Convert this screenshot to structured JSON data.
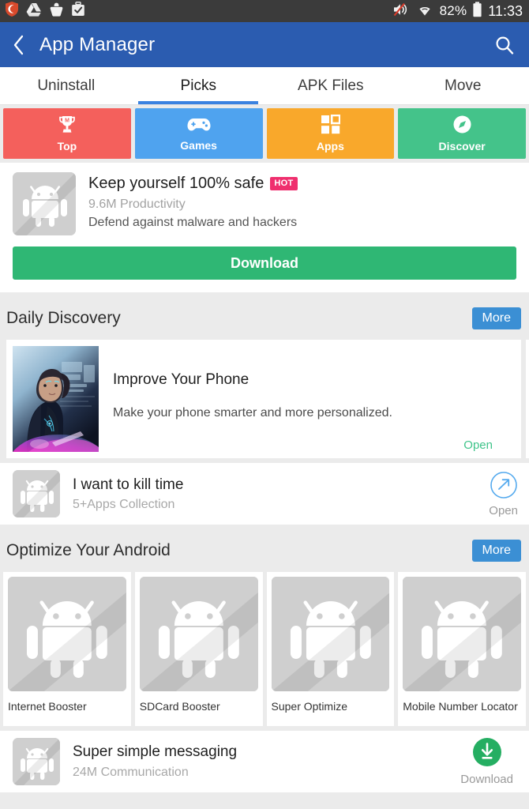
{
  "statusbar": {
    "icons_left": [
      "shield-icon",
      "drive-icon",
      "bag-icon",
      "briefcase-check-icon"
    ],
    "volume_icon": "volume-muted-icon",
    "wifi_icon": "wifi-icon",
    "battery_percent": "82%",
    "battery_icon": "battery-icon",
    "time": "11:33"
  },
  "appbar": {
    "back_icon": "back-chevron-icon",
    "title": "App Manager",
    "search_icon": "search-icon"
  },
  "tabs": [
    {
      "label": "Uninstall",
      "active": false
    },
    {
      "label": "Picks",
      "active": true
    },
    {
      "label": "APK Files",
      "active": false
    },
    {
      "label": "Move",
      "active": false
    }
  ],
  "categories": [
    {
      "label": "Top",
      "icon": "trophy-icon",
      "color": "#f4605c"
    },
    {
      "label": "Games",
      "icon": "gamepad-icon",
      "color": "#4fa3ef"
    },
    {
      "label": "Apps",
      "icon": "grid-icon",
      "color": "#f9a82b"
    },
    {
      "label": "Discover",
      "icon": "compass-icon",
      "color": "#44c38a"
    }
  ],
  "feature": {
    "icon": "android-placeholder-icon",
    "title": "Keep yourself 100% safe",
    "badge": "HOT",
    "meta": "9.6M Productivity",
    "description": "Defend against malware and hackers",
    "button_label": "Download"
  },
  "daily_discovery": {
    "title": "Daily Discovery",
    "more_label": "More",
    "cards": [
      {
        "image": "woman-tech-hologram-image",
        "title": "Improve Your Phone",
        "description": "Make your phone smarter and more personalized.",
        "action_label": "Open"
      }
    ]
  },
  "collection": {
    "icon": "android-placeholder-icon",
    "title": "I want to kill time",
    "subtitle": "5+Apps Collection",
    "action_icon": "arrow-up-right-circle-icon",
    "action_label": "Open"
  },
  "optimize": {
    "title": "Optimize Your Android",
    "more_label": "More",
    "apps": [
      {
        "name": "Internet Booster",
        "icon": "android-placeholder-icon"
      },
      {
        "name": "SDCard Booster",
        "icon": "android-placeholder-icon"
      },
      {
        "name": "Super Optimize",
        "icon": "android-placeholder-icon"
      },
      {
        "name": "Mobile Number Locator",
        "icon": "android-placeholder-icon"
      }
    ]
  },
  "bottom_app": {
    "icon": "android-placeholder-icon",
    "title": "Super simple messaging",
    "subtitle": "24M Communication",
    "action_icon": "download-circle-icon",
    "action_label": "Download"
  },
  "colors": {
    "appbar": "#2b5cb0",
    "tab_active": "#3b82e0",
    "accent_green": "#2fb774",
    "badge_pink": "#ef2f6e",
    "more_blue": "#3b8fd4",
    "open_blue": "#55aaee",
    "placeholder_gray": "#cfcfcf"
  }
}
